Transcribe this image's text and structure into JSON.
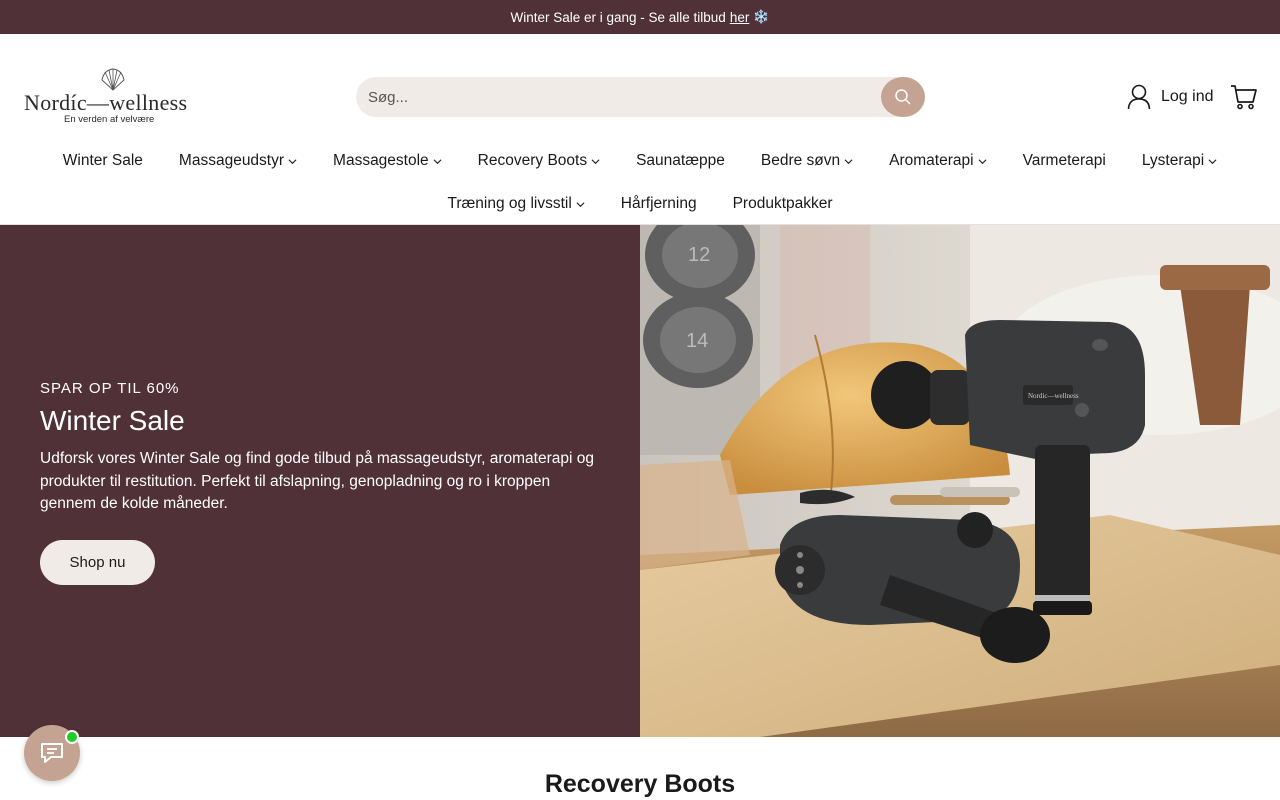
{
  "announcement": {
    "text": "Winter Sale er i gang - Se alle tilbud",
    "link": "her",
    "emoji": "❄️"
  },
  "logo": {
    "name": "Nordíc—wellness",
    "tagline": "En verden af velvære"
  },
  "search": {
    "placeholder": "Søg..."
  },
  "account": {
    "login_label": "Log ind"
  },
  "nav": {
    "row1": [
      {
        "label": "Winter Sale",
        "has_dropdown": false
      },
      {
        "label": "Massageudstyr",
        "has_dropdown": true
      },
      {
        "label": "Massagestole",
        "has_dropdown": true
      },
      {
        "label": "Recovery Boots",
        "has_dropdown": true
      },
      {
        "label": "Saunatæppe",
        "has_dropdown": false
      },
      {
        "label": "Bedre søvn",
        "has_dropdown": true
      },
      {
        "label": "Aromaterapi",
        "has_dropdown": true
      },
      {
        "label": "Varmeterapi",
        "has_dropdown": false
      },
      {
        "label": "Lysterapi",
        "has_dropdown": true
      }
    ],
    "row2": [
      {
        "label": "Træning og livsstil",
        "has_dropdown": true
      },
      {
        "label": "Hårfjerning",
        "has_dropdown": false
      },
      {
        "label": "Produktpakker",
        "has_dropdown": false
      }
    ]
  },
  "hero": {
    "eyebrow": "SPAR OP TIL 60%",
    "title": "Winter Sale",
    "text": "Udforsk vores Winter Sale og find gode tilbud på massageudstyr, aromaterapi og produkter til restitution. Perfekt til afslapning, genopladning og ro i kroppen gennem de kolde måneder.",
    "button": "Shop nu",
    "image_product_label": "Nordic—wellness",
    "dumbbell_labels": [
      "12",
      "14"
    ]
  },
  "section": {
    "title": "Recovery Boots"
  },
  "colors": {
    "brand": "#513138",
    "accent": "#c4a393",
    "light": "#f1ebe7",
    "online": "#1fcc2a"
  },
  "icons": {
    "search": "search-icon",
    "user": "user-icon",
    "cart": "cart-icon",
    "chat": "chat-icon",
    "chevron": "chevron-down-icon"
  }
}
